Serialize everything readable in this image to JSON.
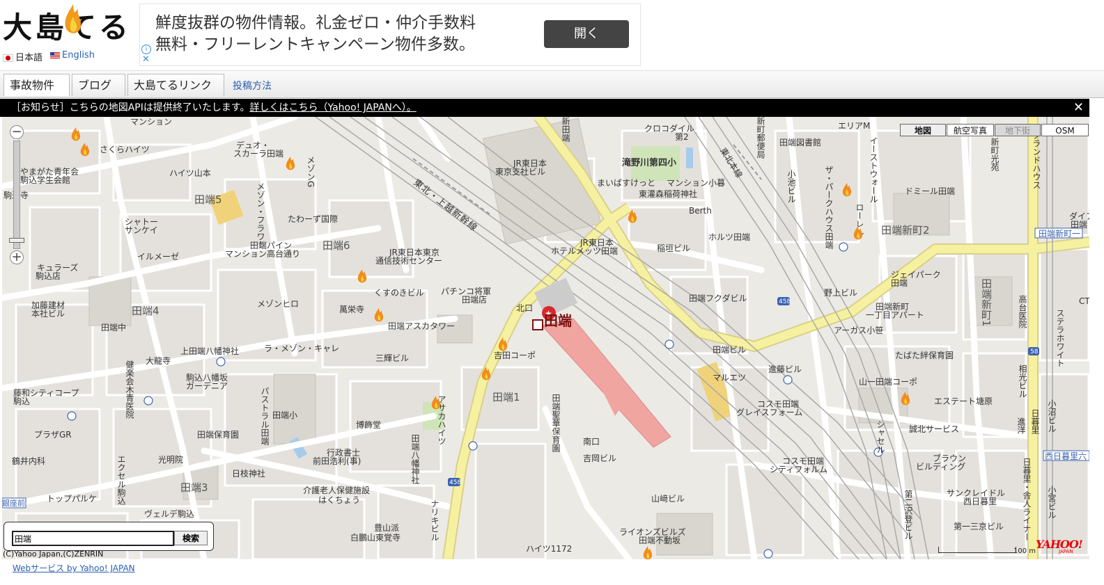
{
  "header": {
    "logo_text": "大島てる",
    "lang_ja": "日本語",
    "lang_en": "English"
  },
  "ad": {
    "line1": "鮮度抜群の物件情報。礼金ゼロ・仲介手数料",
    "line2": "無料・フリーレントキャンペーン物件多数。",
    "button": "開く",
    "info": "i",
    "close": "✕"
  },
  "nav": {
    "tab1": "事故物件",
    "tab2": "ブログ",
    "tab3": "大島てるリンク",
    "link": "投稿方法"
  },
  "notice": {
    "prefix": "［お知らせ］こちらの地図APIは提供終了いたします。",
    "link": "詳しくはこちら（Yahoo! JAPANへ）。",
    "close": "✕"
  },
  "maptypes": [
    "地図",
    "航空写真",
    "地下街",
    "OSM"
  ],
  "zoom": {
    "plus": "+",
    "minus": "−",
    "level": 0.93
  },
  "search": {
    "value": "田端",
    "button": "検索"
  },
  "footer": {
    "copyright": "(C)Yahoo Japan,(C)ZENRIN",
    "webservice": "Webサービス by Yahoo! JAPAN",
    "scale": "100 m",
    "yahoo": "YAHOO!",
    "yahoo_sub": "JAPAN"
  },
  "station": "田端",
  "colors": {
    "road_yellow": "#f6f1a0",
    "road_white": "#ffffff",
    "block": "#e4e1dc",
    "rail": "#a9a9a9",
    "park": "#cfe5b9",
    "building": "#f0d27a",
    "platform": "#f1a5a0"
  },
  "labels": {
    "cat1": "さくらハイツ",
    "cat2": "やまがた青年会",
    "cat3": "駒込学生会館",
    "cat4": "ハイツ山本",
    "cat5": "デュオ・",
    "cat6": "スカーラ田端",
    "cat7": "マンション",
    "cat8": "田端5",
    "cat9": "たわーず国際",
    "cat10": "シャトー",
    "cat11": "サンケイ",
    "cat12": "田端パイン",
    "cat13": "マンション高台通り",
    "cat14": "田端6",
    "cat15": "イルメーゼ",
    "cat16": "キュラーズ",
    "cat17": "駒込店",
    "cat18": "JR東日本東京",
    "cat19": "通信技術センター",
    "cat20": "くすのきビル",
    "cat21": "加藤建材",
    "cat22": "本社ビル",
    "cat23": "メゾンヒロ",
    "cat24": "萬栄寺",
    "cat25": "田端4",
    "cat26": "田端中",
    "cat27": "田端アスカタワー",
    "cat28": "パチンコ将軍",
    "cat29": "田端店",
    "cat30": "上田端八幡神社",
    "cat31": "ラ・メゾン・キャレ",
    "cat32": "大龍寺",
    "cat33": "三輝ビル",
    "cat34": "吉田コーポ",
    "cat35": "駒込八幡坂",
    "cat36": "ガーデニア",
    "cat37": "藤和シティコープ",
    "cat38": "駒込",
    "cat39": "田端小",
    "cat40": "博飾堂",
    "cat41": "田端1",
    "cat42": "プラザGR",
    "cat43": "田端保育園",
    "cat44": "行政書士",
    "cat45": "前田浩利(事)",
    "cat46": "光明院",
    "cat47": "鶴井内科",
    "cat48": "日枝神社",
    "cat49": "田端3",
    "cat50": "トップパルケ",
    "cat51": "介護老人保健施設",
    "cat52": "はくちょう",
    "cat53": "ヴェルデ駒込",
    "cat54": "豊山派",
    "cat55": "白鵬山東覚寺",
    "cat56": "ハイツ1172",
    "cat57": "山﨑ビル",
    "cat58": "ライオンズビルズ",
    "cat59": "田端不動坂",
    "cat60": "吉岡ビル",
    "cat61": "JR東日本",
    "cat62": "東京支社ビル",
    "cat63": "JR東日本",
    "cat64": "ホテルメッツ田端",
    "cat65": "北口",
    "cat66": "南口",
    "cat67": "クロコダイル",
    "cat68": "第2",
    "cat69": "滝野川第四小",
    "cat70": "まいばすけっと",
    "cat71": "マンション小暮",
    "cat72": "東灌森稲荷神社",
    "cat73": "Berth",
    "cat74": "ホルツ田端",
    "cat75": "稲垣ビル",
    "cat76": "田端フクダビル",
    "cat77": "田端ビル",
    "cat78": "マルエツ",
    "cat79": "進藤ビル",
    "cat80": "コスモ田端",
    "cat81": "グレイスフォーム",
    "cat82": "コスモ田端",
    "cat83": "シティフォルム",
    "cat84": "エリアM",
    "cat85": "田端図書館",
    "cat86": "ドミール田端",
    "cat87": "田端新町2",
    "cat88": "ジェイパーク",
    "cat89": "田端",
    "cat90": "野上ビル",
    "cat91": "田端新町",
    "cat92": "一丁目アパート",
    "cat93": "アーガス小笹",
    "cat94": "たばた絆保育園",
    "cat95": "山一田端コーポ",
    "cat96": "エステート塘原",
    "cat97": "誠北サービス",
    "cat98": "ブラウン",
    "cat99": "ビルディング",
    "cat100": "サンクレイドル",
    "cat101": "西日暮里",
    "cat102": "第一三京ビル",
    "cat103": "高台医院",
    "cat104": "田端新町1",
    "cat105": "田端新町一",
    "cat106": "西日暮里六",
    "cat107": "東北・上越新幹線",
    "cat108": "東北本線",
    "cat109": "田端聖華保育園",
    "cat110": "メゾンG",
    "cat111": "メゾン・フラワー",
    "cat112": "健楽会木青医院",
    "cat113": "パストラル田端",
    "cat114": "エクセル駒込",
    "cat115": "田端八幡神社",
    "cat116": "アサカハイツ",
    "cat117": "ナリキビル",
    "cat118": "ザ・パークハウス田端",
    "cat119": "ローレル",
    "cat120": "小池ビル",
    "cat121": "イーストウォール",
    "cat122": "日暮里・舎人ライナー",
    "cat123": "ステラホワイト",
    "cat124": "相光ビル",
    "cat125": "小沼ビル",
    "cat126": "小宮ビル",
    "cat127": "第二沢登ビル",
    "cat128": "シャセル",
    "cat129": "日暮里",
    "cat130": "新町光苑",
    "cat131": "グランドハウス",
    "cat132": "ダイア",
    "cat133": "田端",
    "cat134": "CT",
    "cat135": "進洋",
    "cat136": "新田端",
    "cat137": "駒込寺",
    "cat138": "銀座前",
    "cat139": "新町郵便局"
  }
}
